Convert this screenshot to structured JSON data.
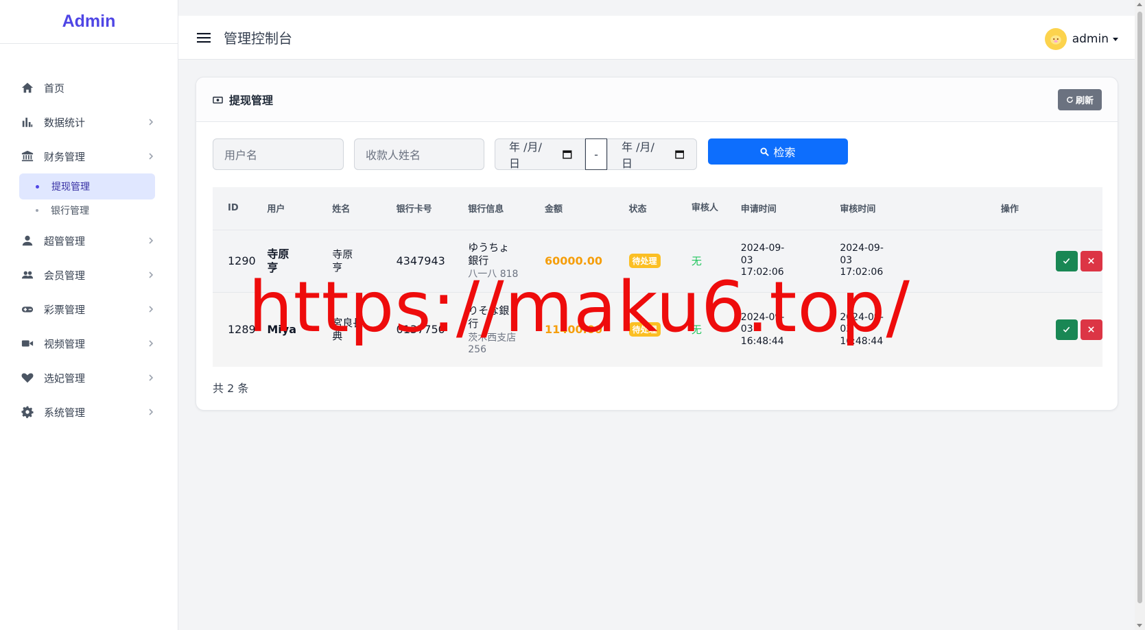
{
  "brand": "Admin",
  "sidebar": {
    "items": [
      {
        "label": "首页",
        "icon": "home-icon",
        "has_children": false
      },
      {
        "label": "数据统计",
        "icon": "bar-chart-icon",
        "has_children": true
      },
      {
        "label": "财务管理",
        "icon": "bank-icon",
        "has_children": true
      },
      {
        "label": "超管管理",
        "icon": "user-icon",
        "has_children": true
      },
      {
        "label": "会员管理",
        "icon": "users-icon",
        "has_children": true
      },
      {
        "label": "彩票管理",
        "icon": "gamepad-icon",
        "has_children": true
      },
      {
        "label": "视频管理",
        "icon": "video-icon",
        "has_children": true
      },
      {
        "label": "选妃管理",
        "icon": "heart-icon",
        "has_children": true
      },
      {
        "label": "系统管理",
        "icon": "gear-icon",
        "has_children": true
      }
    ],
    "finance_sub": [
      {
        "label": "提现管理",
        "active": true
      },
      {
        "label": "银行管理",
        "active": false
      }
    ]
  },
  "header": {
    "title": "管理控制台",
    "user": "admin"
  },
  "card": {
    "title": "提现管理",
    "refresh_label": "刷新",
    "filters": {
      "username_placeholder": "用户名",
      "payee_placeholder": "收款人姓名",
      "date_start": "年 /月/日",
      "date_sep": "-",
      "date_end": "年 /月/日",
      "search_label": "检索"
    },
    "table": {
      "headers": [
        "ID",
        "用户",
        "姓名",
        "银行卡号",
        "银行信息",
        "金额",
        "状态",
        "审核人",
        "申请时间",
        "审核时间",
        "操作"
      ],
      "rows": [
        {
          "id": "1290",
          "user": "寺原亨",
          "name": "寺原亨",
          "card": "4347943",
          "bank": "ゆうちょ銀行",
          "branch": "八一八 818",
          "amount": "60000.00",
          "status": "待处理",
          "reviewer": "无",
          "apply_time": "2024-09-03 17:02:06",
          "review_time": "2024-09-03 17:02:06"
        },
        {
          "id": "1289",
          "user": "Miya",
          "name": "宮良長典",
          "card": "0137750",
          "bank": "りそな銀行",
          "branch": "茨木西支店 256",
          "amount": "11400.00",
          "status": "待处理",
          "reviewer": "无",
          "apply_time": "2024-09-03 16:48:44",
          "review_time": "2024-09-03 16:48:44"
        }
      ]
    },
    "total": "共 2 条"
  },
  "watermark": "https://maku6.top/",
  "colors": {
    "brand": "#4f46e5",
    "primary": "#0d6efd",
    "amount": "#f59e0b",
    "status": "#fbbf24",
    "approve": "#198754",
    "reject": "#dc3545",
    "watermark": "#ee0c0c"
  }
}
